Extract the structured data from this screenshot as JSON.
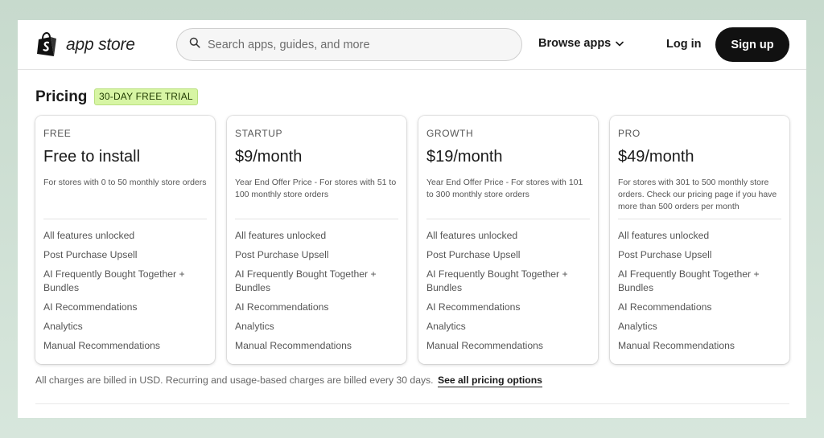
{
  "header": {
    "logo_text": "app store",
    "search_placeholder": "Search apps, guides, and more",
    "browse_label": "Browse apps",
    "login_label": "Log in",
    "signup_label": "Sign up"
  },
  "pricing": {
    "title": "Pricing",
    "trial_badge": "30-DAY FREE TRIAL",
    "plans": [
      {
        "name": "FREE",
        "price": "Free to install",
        "description": "For stores with 0 to 50 monthly store orders",
        "features": [
          "All features unlocked",
          "Post Purchase Upsell",
          "AI Frequently Bought Together + Bundles",
          "AI Recommendations",
          "Analytics",
          "Manual Recommendations"
        ]
      },
      {
        "name": "STARTUP",
        "price": "$9/month",
        "description": "Year End Offer Price - For stores with 51 to 100 monthly store orders",
        "features": [
          "All features unlocked",
          "Post Purchase Upsell",
          "AI Frequently Bought Together + Bundles",
          "AI Recommendations",
          "Analytics",
          "Manual Recommendations"
        ]
      },
      {
        "name": "GROWTH",
        "price": "$19/month",
        "description": "Year End Offer Price - For stores with 101 to 300 monthly store orders",
        "features": [
          "All features unlocked",
          "Post Purchase Upsell",
          "AI Frequently Bought Together + Bundles",
          "AI Recommendations",
          "Analytics",
          "Manual Recommendations"
        ]
      },
      {
        "name": "PRO",
        "price": "$49/month",
        "description": "For stores with 301 to 500 monthly store orders. Check our pricing page if you have more than 500 orders per month",
        "features": [
          "All features unlocked",
          "Post Purchase Upsell",
          "AI Frequently Bought Together + Bundles",
          "AI Recommendations",
          "Analytics",
          "Manual Recommendations"
        ]
      }
    ],
    "billing_note": "All charges are billed in USD. Recurring and usage-based charges are billed every 30 days.",
    "billing_link": "See all pricing options"
  },
  "colors": {
    "background": "#c9dccf",
    "badge_bg": "#d7f5a4",
    "signup_bg": "#111111",
    "logo_green": "#111111"
  },
  "icons": {
    "logo": "shopping-bag-icon",
    "search": "search-icon",
    "browse": "chevron-down-icon"
  }
}
